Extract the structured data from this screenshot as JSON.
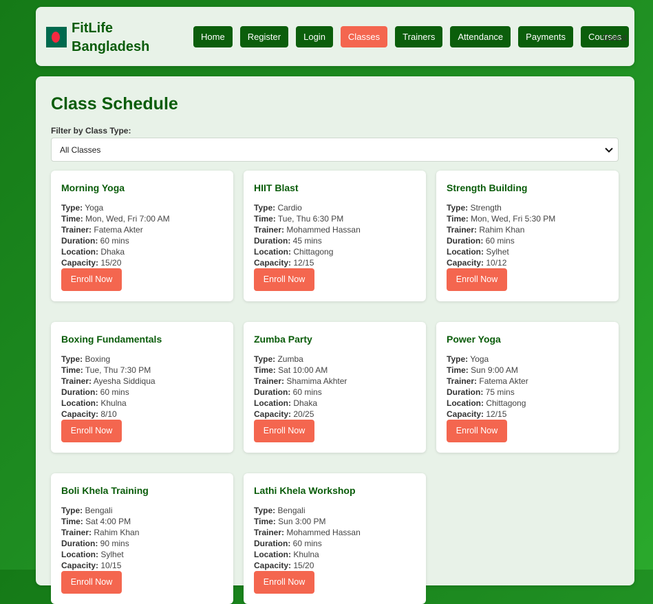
{
  "brand": {
    "name": "FitLife Bangladesh"
  },
  "nav": [
    {
      "label": "Home"
    },
    {
      "label": "Register"
    },
    {
      "label": "Login"
    },
    {
      "label": "Classes"
    },
    {
      "label": "Trainers"
    },
    {
      "label": "Attendance"
    },
    {
      "label": "Payments"
    },
    {
      "label": "Courses"
    }
  ],
  "user": {
    "label": "Guest"
  },
  "page": {
    "title": "Class Schedule",
    "filter_label": "Filter by Class Type:",
    "filter_value": "All Classes"
  },
  "labels": {
    "type": "Type:",
    "time": "Time:",
    "trainer": "Trainer:",
    "duration": "Duration:",
    "location": "Location:",
    "capacity": "Capacity:",
    "enroll": "Enroll Now"
  },
  "classes": [
    {
      "name": "Morning Yoga",
      "type": "Yoga",
      "time": "Mon, Wed, Fri 7:00 AM",
      "trainer": "Fatema Akter",
      "duration": "60 mins",
      "location": "Dhaka",
      "capacity": "15/20"
    },
    {
      "name": "HIIT Blast",
      "type": "Cardio",
      "time": "Tue, Thu 6:30 PM",
      "trainer": "Mohammed Hassan",
      "duration": "45 mins",
      "location": "Chittagong",
      "capacity": "12/15"
    },
    {
      "name": "Strength Building",
      "type": "Strength",
      "time": "Mon, Wed, Fri 5:30 PM",
      "trainer": "Rahim Khan",
      "duration": "60 mins",
      "location": "Sylhet",
      "capacity": "10/12"
    },
    {
      "name": "Boxing Fundamentals",
      "type": "Boxing",
      "time": "Tue, Thu 7:30 PM",
      "trainer": "Ayesha Siddiqua",
      "duration": "60 mins",
      "location": "Khulna",
      "capacity": "8/10"
    },
    {
      "name": "Zumba Party",
      "type": "Zumba",
      "time": "Sat 10:00 AM",
      "trainer": "Shamima Akhter",
      "duration": "60 mins",
      "location": "Dhaka",
      "capacity": "20/25"
    },
    {
      "name": "Power Yoga",
      "type": "Yoga",
      "time": "Sun 9:00 AM",
      "trainer": "Fatema Akter",
      "duration": "75 mins",
      "location": "Chittagong",
      "capacity": "12/15"
    },
    {
      "name": "Boli Khela Training",
      "type": "Bengali",
      "time": "Sat 4:00 PM",
      "trainer": "Rahim Khan",
      "duration": "90 mins",
      "location": "Sylhet",
      "capacity": "10/15"
    },
    {
      "name": "Lathi Khela Workshop",
      "type": "Bengali",
      "time": "Sun 3:00 PM",
      "trainer": "Mohammed Hassan",
      "duration": "60 mins",
      "location": "Khulna",
      "capacity": "15/20"
    }
  ]
}
